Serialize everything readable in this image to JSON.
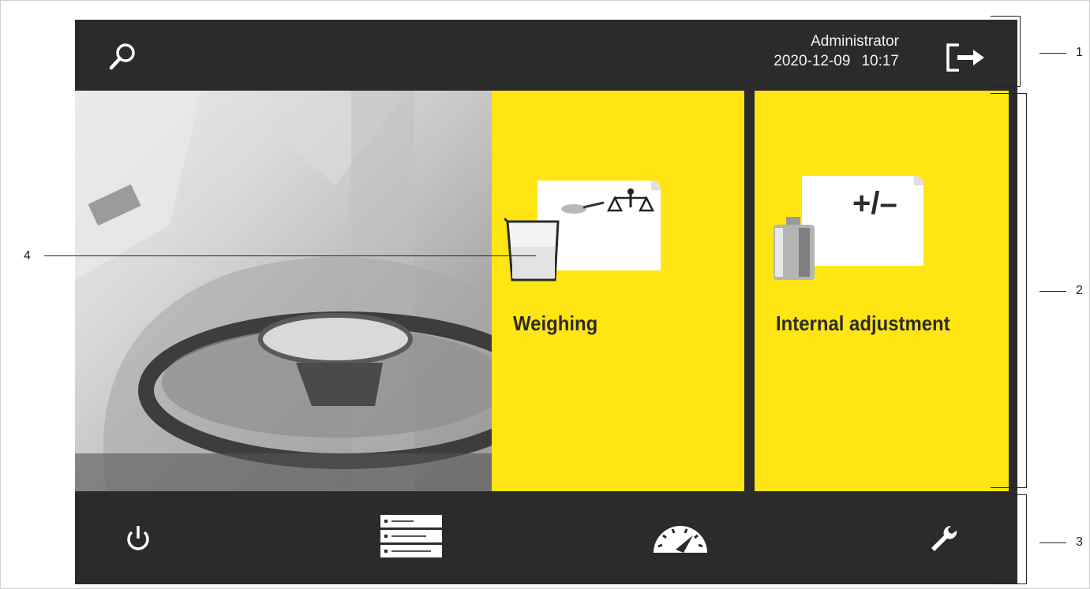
{
  "header": {
    "user_name": "Administrator",
    "date": "2020-12-09",
    "time": "10:17"
  },
  "tiles": [
    {
      "label": "Weighing",
      "icon": "weighing-icon"
    },
    {
      "label": "Internal adjustment",
      "icon": "internal-adjustment-icon"
    }
  ],
  "adjust_icon_text": "+/–",
  "footer": {
    "icons": [
      "power-icon",
      "task-list-icon",
      "speedometer-icon",
      "wrench-icon"
    ]
  },
  "callouts": [
    "1",
    "2",
    "3",
    "4"
  ],
  "colors": {
    "bar": "#2b2b2b",
    "tile": "#ffe514",
    "text_light": "#f2f2f2"
  }
}
